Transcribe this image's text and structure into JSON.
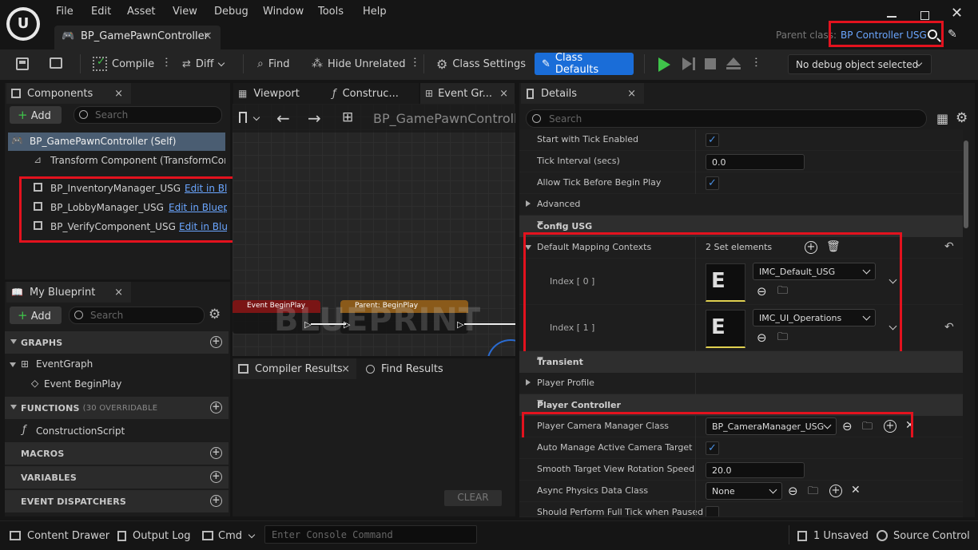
{
  "menu": [
    "File",
    "Edit",
    "Asset",
    "View",
    "Debug",
    "Window",
    "Tools",
    "Help"
  ],
  "tab": {
    "title": "BP_GamePawnController",
    "close": "×"
  },
  "parent_class": {
    "label": "Parent class:",
    "value": "BP Controller USG"
  },
  "toolbar": {
    "compile": "Compile",
    "diff": "Diff",
    "find": "Find",
    "hide_unrelated": "Hide Unrelated",
    "class_settings": "Class Settings",
    "class_defaults": "Class Defaults",
    "debug_object": "No debug object selected"
  },
  "components": {
    "title": "Components",
    "add": "Add",
    "search_placeholder": "Search",
    "root": "BP_GamePawnController (Self)",
    "transform": "Transform Component (TransformComponent)",
    "items": [
      {
        "name": "BP_InventoryManager_USG",
        "link": "Edit in Blueprint"
      },
      {
        "name": "BP_LobbyManager_USG",
        "link": "Edit in Blueprint"
      },
      {
        "name": "BP_VerifyComponent_USG",
        "link": "Edit in Blueprint"
      }
    ]
  },
  "my_blueprint": {
    "title": "My Blueprint",
    "add": "Add",
    "search_placeholder": "Search",
    "graphs": "GRAPHS",
    "event_graph": "EventGraph",
    "event_begin_play": "Event BeginPlay",
    "functions": "FUNCTIONS",
    "functions_note": "(30 OVERRIDABLE",
    "construction_script": "ConstructionScript",
    "macros": "MACROS",
    "variables": "VARIABLES",
    "event_dispatchers": "EVENT DISPATCHERS"
  },
  "center": {
    "tabs": [
      "Viewport",
      "Construc...",
      "Event Gr..."
    ],
    "breadcrumb": "BP_GamePawnController",
    "watermark": "BLUEPRINT",
    "node1": "Event BeginPlay",
    "node2": "Parent: BeginPlay",
    "compiler_results": "Compiler Results",
    "find_results": "Find Results",
    "clear": "CLEAR"
  },
  "details": {
    "title": "Details",
    "search_placeholder": "Search",
    "start_tick": "Start with Tick Enabled",
    "tick_interval": "Tick Interval (secs)",
    "tick_interval_value": "0.0",
    "allow_tick": "Allow Tick Before Begin Play",
    "advanced": "Advanced",
    "config_usg": "Config USG",
    "default_mapping": "Default Mapping Contexts",
    "set_elements": "2 Set elements",
    "index0": "Index [ 0 ]",
    "index0_value": "IMC_Default_USG",
    "index1": "Index [ 1 ]",
    "index1_value": "IMC_UI_Operations",
    "transient": "Transient",
    "player_profile": "Player Profile",
    "player_controller": "Player Controller",
    "camera_manager": "Player Camera Manager Class",
    "camera_manager_value": "BP_CameraManager_USG",
    "auto_manage": "Auto Manage Active Camera Target",
    "smooth_target": "Smooth Target View Rotation Speed",
    "smooth_value": "20.0",
    "async_physics": "Async Physics Data Class",
    "async_value": "None",
    "full_tick": "Should Perform Full Tick when Paused"
  },
  "bottom": {
    "content_drawer": "Content Drawer",
    "output_log": "Output Log",
    "cmd": "Cmd",
    "console_placeholder": "Enter Console Command",
    "unsaved": "1 Unsaved",
    "source_control": "Source Control"
  },
  "colors": {
    "accent_blue": "#1a6dd8",
    "link_blue": "#6aa6ff",
    "highlight_red": "#e3121e",
    "play_green": "#3fc44a"
  }
}
